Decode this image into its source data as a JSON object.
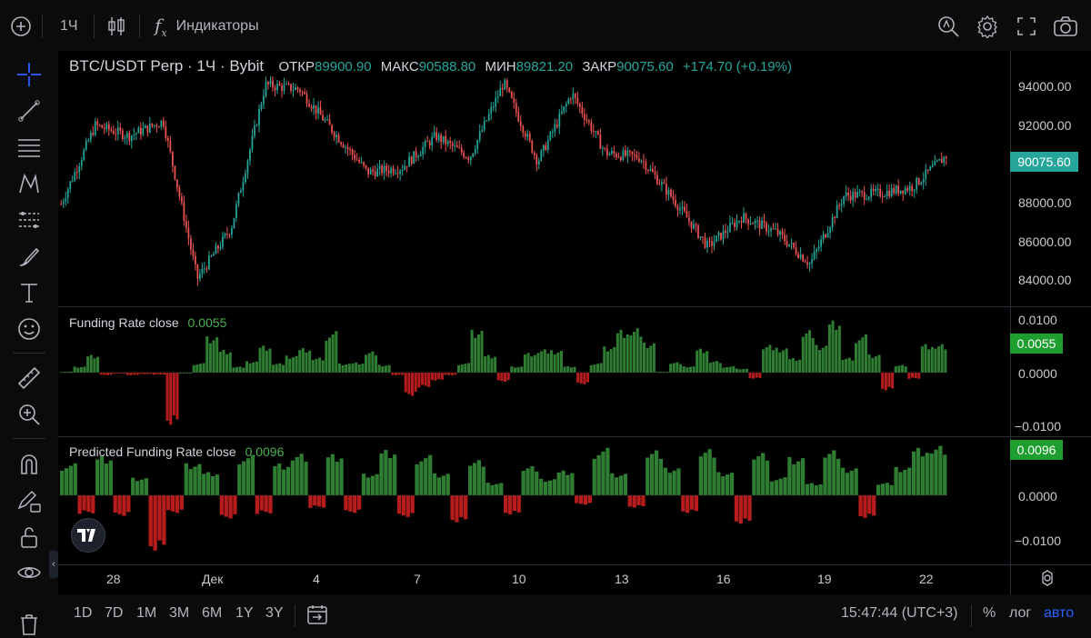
{
  "toolbar": {
    "interval": "1Ч",
    "indicators_label": "Индикаторы"
  },
  "legend": {
    "symbol": "BTC/USDT Perp · 1Ч · Bybit",
    "open_label": "ОТКР",
    "open": "89900.90",
    "high_label": "МАКС",
    "high": "90588.80",
    "low_label": "МИН",
    "low": "89821.20",
    "close_label": "ЗАКР",
    "close": "90075.60",
    "change": "+174.70 (+0.19%)"
  },
  "price_axis": {
    "labels": [
      "94000.00",
      "92000.00",
      "88000.00",
      "86000.00",
      "84000.00"
    ],
    "current_price": "90075.60"
  },
  "funding_pane": {
    "title": "Funding Rate close",
    "value": "0.0055",
    "axis_labels": [
      "0.0100",
      "0.0000",
      "−0.0100"
    ],
    "badge": "0.0055"
  },
  "predicted_pane": {
    "title": "Predicted Funding Rate close",
    "value": "0.0096",
    "axis_labels": [
      "0.0000",
      "−0.0100"
    ],
    "badge": "0.0096"
  },
  "time_axis": [
    "28",
    "Дек",
    "4",
    "7",
    "10",
    "13",
    "16",
    "19",
    "22"
  ],
  "bottom": {
    "ranges": [
      "1D",
      "7D",
      "1M",
      "3M",
      "6M",
      "1Y",
      "3Y"
    ],
    "clock": "15:47:44 (UTC+3)",
    "percent": "%",
    "log": "лог",
    "auto": "авто"
  },
  "colors": {
    "up": "#26a69a",
    "down": "#ef5350",
    "hist_pos": "#2e7d32",
    "hist_neg": "#b71c1c",
    "accent": "#2962ff",
    "badge_green": "#1e9e2e"
  },
  "chart_data": [
    {
      "type": "candlestick",
      "title": "BTC/USDT Perp · 1Ч · Bybit",
      "x_ticks": [
        "28",
        "Дек",
        "4",
        "7",
        "10",
        "13",
        "16",
        "19",
        "22"
      ],
      "ylim": [
        83000,
        95000
      ],
      "y_ticks": [
        84000,
        86000,
        88000,
        92000,
        94000
      ],
      "approx_close_path": [
        {
          "x": "27",
          "y": 87800
        },
        {
          "x": "28",
          "y": 91500
        },
        {
          "x": "29",
          "y": 91000
        },
        {
          "x": "30",
          "y": 91700
        },
        {
          "x": "Дек",
          "y": 84300
        },
        {
          "x": "2",
          "y": 86700
        },
        {
          "x": "3",
          "y": 93400
        },
        {
          "x": "4",
          "y": 93200
        },
        {
          "x": "5",
          "y": 91200
        },
        {
          "x": "6",
          "y": 89300
        },
        {
          "x": "7",
          "y": 89500
        },
        {
          "x": "8",
          "y": 91000
        },
        {
          "x": "9",
          "y": 90000
        },
        {
          "x": "10",
          "y": 93500
        },
        {
          "x": "11",
          "y": 89800
        },
        {
          "x": "12",
          "y": 93000
        },
        {
          "x": "13",
          "y": 90200
        },
        {
          "x": "14",
          "y": 90000
        },
        {
          "x": "15",
          "y": 88000
        },
        {
          "x": "16",
          "y": 85800
        },
        {
          "x": "17",
          "y": 87200
        },
        {
          "x": "18",
          "y": 86500
        },
        {
          "x": "19",
          "y": 85000
        },
        {
          "x": "20",
          "y": 88200
        },
        {
          "x": "21",
          "y": 88300
        },
        {
          "x": "22",
          "y": 88600
        },
        {
          "x": "23",
          "y": 90075.6
        }
      ]
    },
    {
      "type": "bar",
      "title": "Funding Rate close",
      "ylim": [
        -0.013,
        0.012
      ],
      "y_ticks": [
        0.01,
        0,
        -0.01
      ],
      "approx_values": [
        0.0002,
        0.0012,
        0.0035,
        -0.0005,
        -0.0002,
        -0.0005,
        -0.0003,
        -0.0004,
        -0.0098,
        0.0,
        0.0018,
        0.0072,
        0.0045,
        0.0012,
        0.0022,
        0.0052,
        0.0018,
        0.0032,
        0.0046,
        0.0028,
        0.0078,
        0.0018,
        0.002,
        0.0042,
        0.0015,
        -0.0005,
        -0.0045,
        -0.0028,
        -0.0015,
        -0.0005,
        0.0018,
        0.0085,
        0.0035,
        -0.0018,
        0.0012,
        0.0038,
        0.0045,
        0.0042,
        0.0012,
        -0.0022,
        0.0018,
        0.0052,
        0.0085,
        0.0088,
        0.0058,
        0.0002,
        0.002,
        0.0012,
        0.0045,
        0.0022,
        0.0012,
        0.0008,
        -0.0012,
        0.0055,
        0.0048,
        0.0028,
        0.0082,
        0.0052,
        0.0098,
        0.0028,
        0.0072,
        0.0036,
        -0.0035,
        0.0015,
        -0.0012,
        0.0055,
        0.0055
      ]
    },
    {
      "type": "bar",
      "title": "Predicted Funding Rate close",
      "ylim": [
        -0.013,
        0.011
      ],
      "y_ticks": [
        0,
        -0.01
      ],
      "approx_values": [
        0.0062,
        -0.0038,
        0.008,
        -0.0042,
        0.0035,
        -0.011,
        -0.0035,
        0.0062,
        0.0045,
        -0.0045,
        0.0078,
        -0.0038,
        0.0065,
        0.0085,
        -0.0025,
        0.0082,
        -0.0035,
        0.0042,
        0.0088,
        -0.0042,
        0.0078,
        0.0045,
        -0.0055,
        0.0072,
        0.0025,
        -0.0038,
        0.0058,
        0.0032,
        0.0048,
        -0.0018,
        0.0092,
        0.0045,
        -0.0025,
        0.0092,
        0.0055,
        -0.0035,
        0.0092,
        0.0045,
        -0.0055,
        0.0082,
        0.0035,
        0.0078,
        0.0025,
        0.0092,
        0.0055,
        -0.0045,
        0.0025,
        0.0055,
        0.0092,
        0.0096
      ]
    }
  ]
}
